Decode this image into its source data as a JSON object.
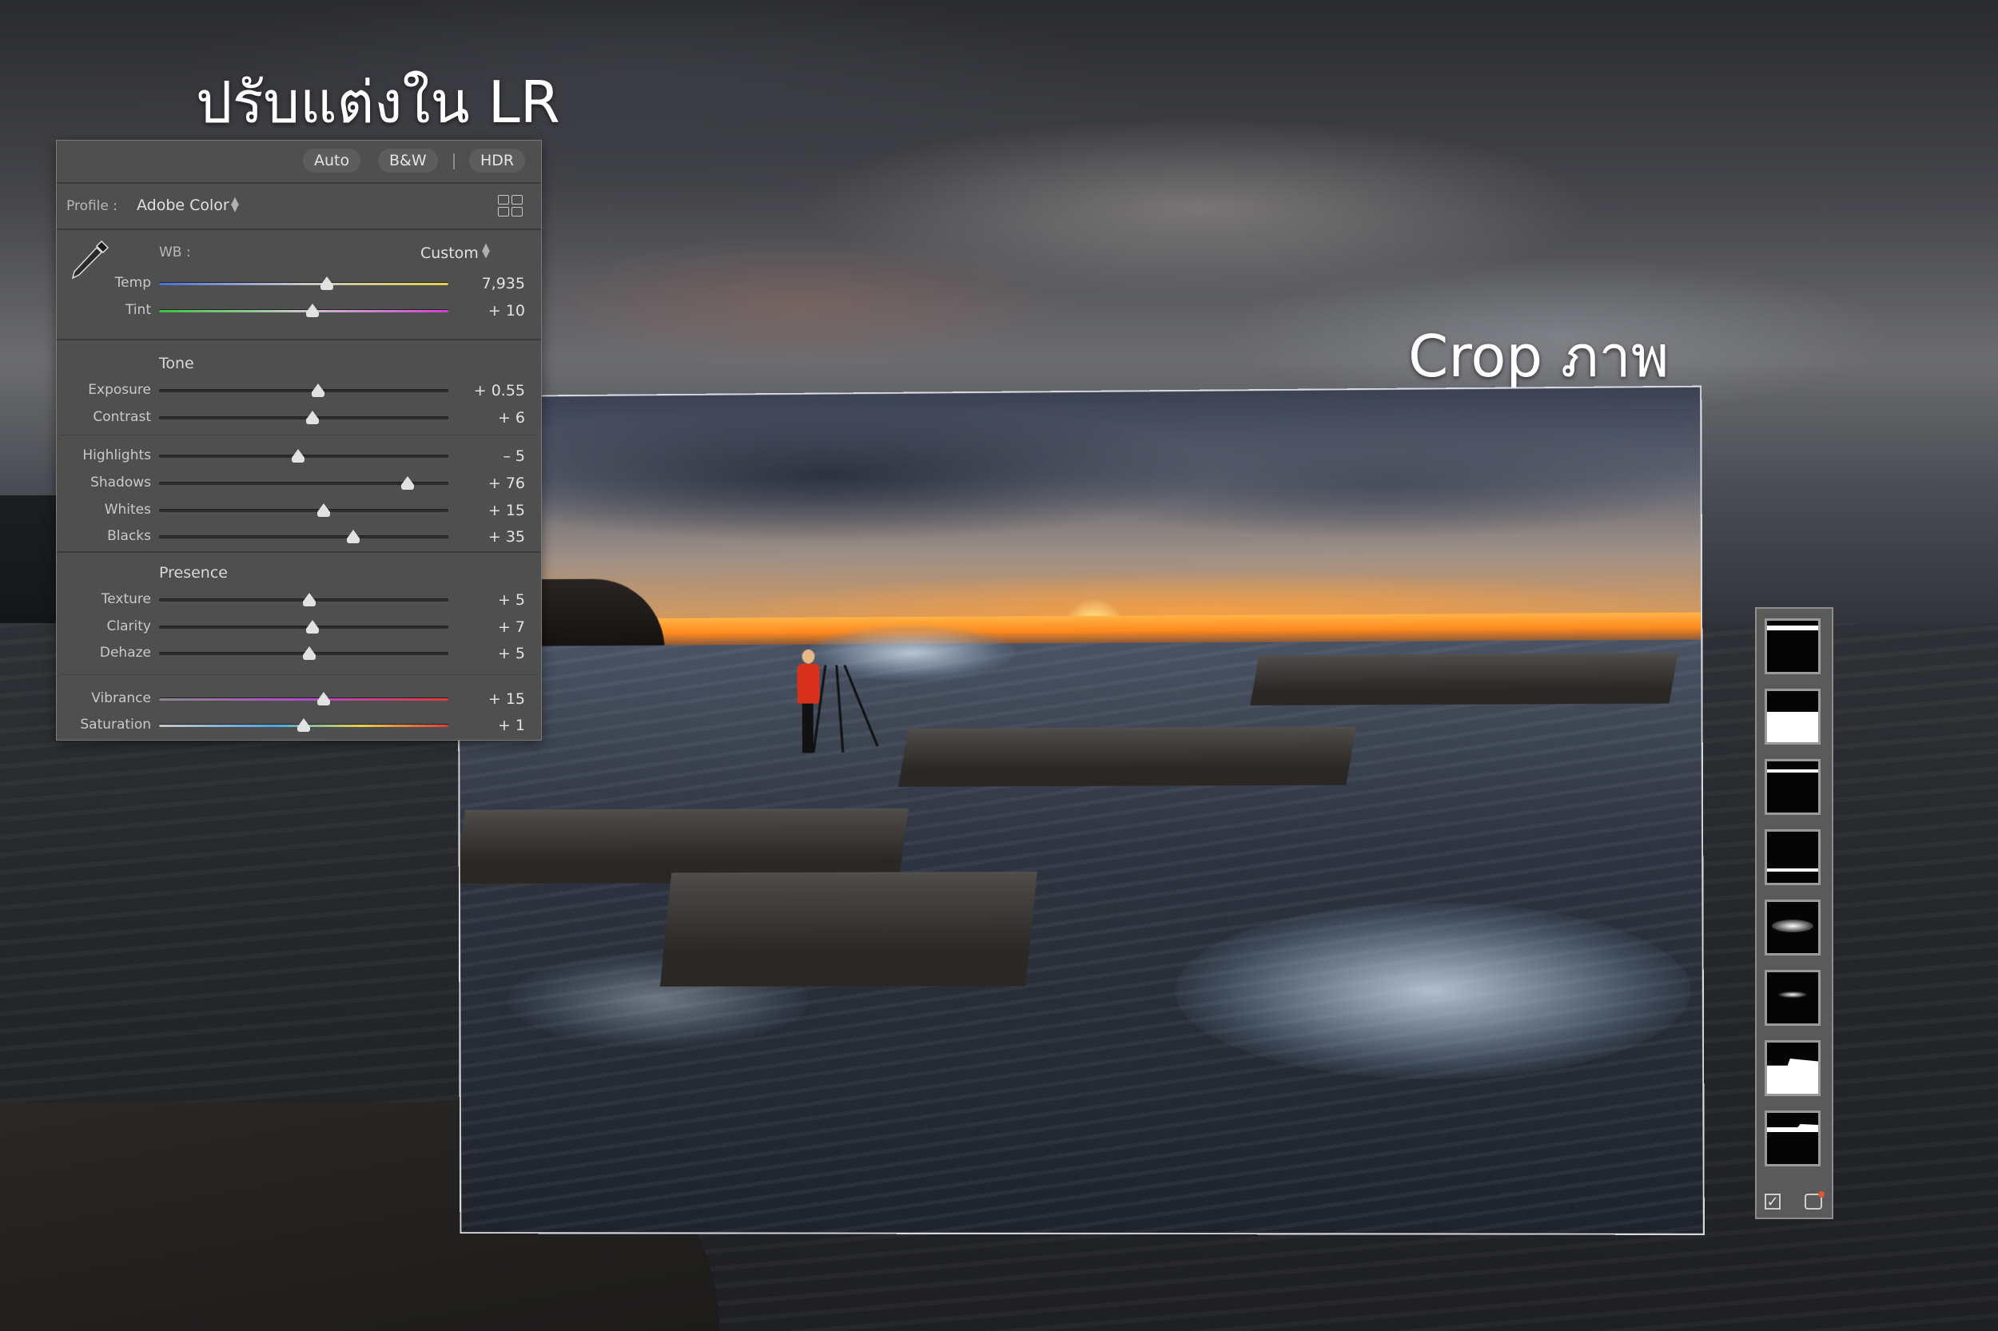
{
  "headings": {
    "left": "ปรับแต่งใน LR",
    "right": "Crop ภาพ"
  },
  "panel": {
    "top_buttons": [
      "Auto",
      "B&W",
      "HDR"
    ],
    "profile_label": "Profile :",
    "profile_value": "Adobe Color",
    "wb_label": "WB :",
    "wb_value": "Custom",
    "sliders": {
      "temp": {
        "label": "Temp",
        "value": "7,935",
        "level": 0.58
      },
      "tint": {
        "label": "Tint",
        "value": "+ 10",
        "level": 0.53
      },
      "exposure": {
        "label": "Exposure",
        "value": "+ 0.55",
        "level": 0.55
      },
      "contrast": {
        "label": "Contrast",
        "value": "+ 6",
        "level": 0.53
      },
      "highlights": {
        "label": "Highlights",
        "value": "– 5",
        "level": 0.48
      },
      "shadows": {
        "label": "Shadows",
        "value": "+ 76",
        "level": 0.86
      },
      "whites": {
        "label": "Whites",
        "value": "+ 15",
        "level": 0.57
      },
      "blacks": {
        "label": "Blacks",
        "value": "+ 35",
        "level": 0.67
      },
      "texture": {
        "label": "Texture",
        "value": "+ 5",
        "level": 0.52
      },
      "clarity": {
        "label": "Clarity",
        "value": "+ 7",
        "level": 0.53
      },
      "dehaze": {
        "label": "Dehaze",
        "value": "+ 5",
        "level": 0.52
      },
      "vibrance": {
        "label": "Vibrance",
        "value": "+ 15",
        "level": 0.57
      },
      "saturation": {
        "label": "Saturation",
        "value": "+ 1",
        "level": 0.5
      }
    },
    "sections": {
      "tone": "Tone",
      "presence": "Presence"
    }
  },
  "icons": {
    "eyedropper": "eyedropper-icon",
    "grid": "profile-browser-grid-icon",
    "check": "checkbox-icon",
    "mask": "mask-add-icon"
  },
  "colors": {
    "panel_bg": "#4f4f4f",
    "accent_orange": "#e0563a"
  }
}
